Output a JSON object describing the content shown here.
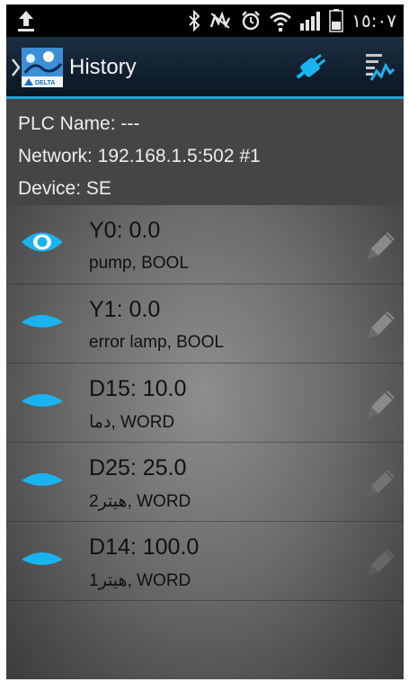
{
  "status_bar": {
    "time": "١٥:٠٧",
    "icons": [
      "upload-icon",
      "bluetooth-icon",
      "vibrate-icon",
      "alarm-icon",
      "wifi-icon",
      "signal-icon",
      "battery-icon"
    ]
  },
  "action_bar": {
    "title": "History",
    "logo_text": "DELTA",
    "icons": [
      "back-chevron-icon",
      "app-logo",
      "connect-plug-icon",
      "chart-icon"
    ]
  },
  "info": {
    "plc_name": "PLC Name: ---",
    "network": "Network: 192.168.1.5:502 #1",
    "device": "Device: SE"
  },
  "items": [
    {
      "title": "Y0: 0.0",
      "subtitle": "pump, BOOL",
      "eye_open": true
    },
    {
      "title": "Y1: 0.0",
      "subtitle": "error lamp, BOOL",
      "eye_open": false
    },
    {
      "title": "D15: 10.0",
      "subtitle": "دما, WORD",
      "eye_open": false
    },
    {
      "title": "D25: 25.0",
      "subtitle": "هيتر2, WORD",
      "eye_open": false
    },
    {
      "title": "D14: 100.0",
      "subtitle": "هيتر1, WORD",
      "eye_open": false
    }
  ],
  "colors": {
    "accent": "#1aa7d6",
    "eye": "#19b4ef",
    "status_bar": "#000000",
    "info_bg": "#454545"
  }
}
